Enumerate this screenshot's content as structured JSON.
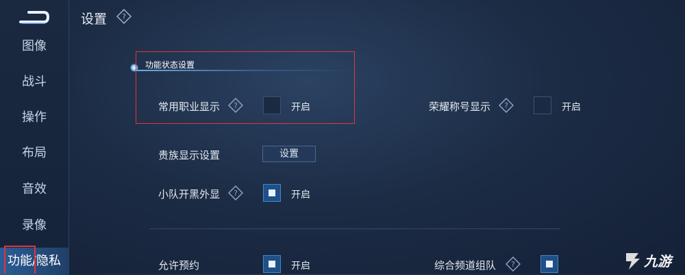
{
  "header": {
    "title": "设置"
  },
  "sidebar": {
    "items": [
      {
        "label": "图像"
      },
      {
        "label": "战斗"
      },
      {
        "label": "操作"
      },
      {
        "label": "布局"
      },
      {
        "label": "音效"
      },
      {
        "label": "录像"
      },
      {
        "label": "功能/隐私"
      }
    ],
    "active_item": "功能/隐私"
  },
  "section": {
    "title": "功能状态设置"
  },
  "settings": {
    "career_display": {
      "label": "常用职业显示",
      "state": "开启",
      "checked": false
    },
    "honor_title_display": {
      "label": "荣耀称号显示",
      "state": "开启",
      "checked": false
    },
    "noble_display": {
      "label": "贵族显示设置",
      "button": "设置"
    },
    "squad_voice": {
      "label": "小队开黑外显",
      "state": "开启",
      "checked": true
    },
    "allow_reservation": {
      "label": "允许预约",
      "state": "开启",
      "checked": true
    },
    "channel_team": {
      "label": "综合频道组队",
      "checked": true
    }
  },
  "watermark": {
    "text": "九游"
  },
  "colors": {
    "highlight_box": "#e3353b",
    "accent": "#2b5d96"
  }
}
